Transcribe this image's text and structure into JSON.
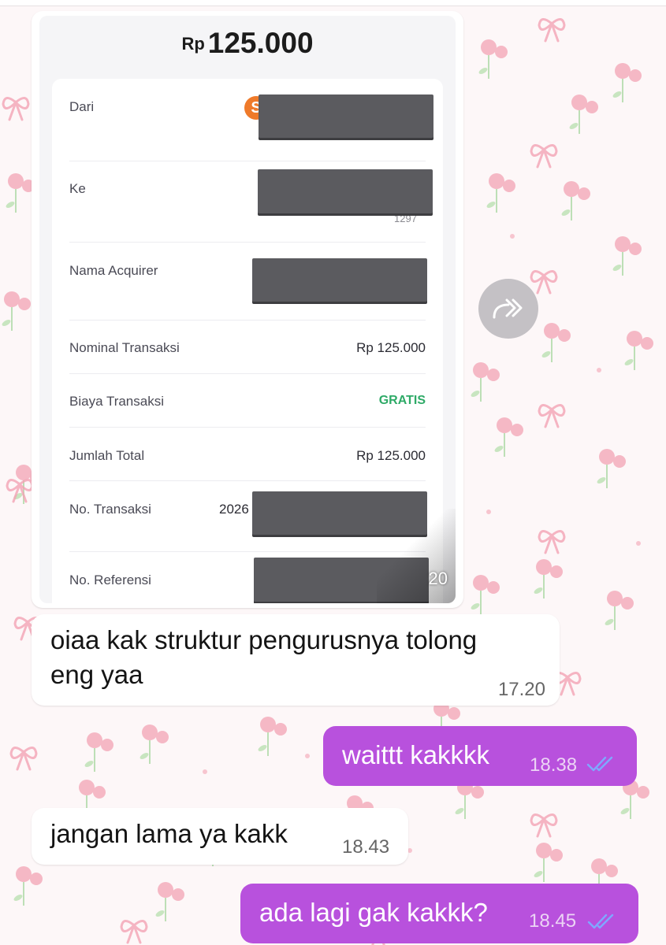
{
  "receipt": {
    "currency": "Rp",
    "amount": "125.000",
    "rows": [
      {
        "label": "Dari",
        "value": ""
      },
      {
        "label": "Ke",
        "value": ""
      },
      {
        "label": "Nama Acquirer",
        "value": ""
      },
      {
        "label": "Nominal Transaksi",
        "value": "Rp 125.000"
      },
      {
        "label": "Biaya Transaksi",
        "value": "GRATIS"
      },
      {
        "label": "Jumlah Total",
        "value": "Rp 125.000"
      },
      {
        "label": "No. Transaksi",
        "value": "2026"
      },
      {
        "label": "No. Referensi",
        "value": ""
      }
    ],
    "partial_text_ke": "1297",
    "logo_letter": "S",
    "image_time": "20"
  },
  "messages": [
    {
      "direction": "incoming",
      "lines": [
        "oiaa kak struktur pengurusnya tolong",
        "eng yaa"
      ],
      "time": "17.20"
    },
    {
      "direction": "outgoing",
      "text": "waittt kakkkk",
      "time": "18.38",
      "status": "read"
    },
    {
      "direction": "incoming",
      "text": "jangan lama ya kakk",
      "time": "18.43"
    },
    {
      "direction": "outgoing",
      "text": "ada lagi gak kakkk?",
      "time": "18.45",
      "status": "read"
    }
  ],
  "colors": {
    "outgoing_bubble": "#b851dd",
    "incoming_bubble": "#ffffff",
    "gratis_green": "#2eaa67",
    "read_ticks": "#7fa8ff",
    "wallpaper_pink": "#f3a3b4"
  },
  "icons": [
    "forward-icon",
    "double-check-icon",
    "bank-logo-icon"
  ]
}
